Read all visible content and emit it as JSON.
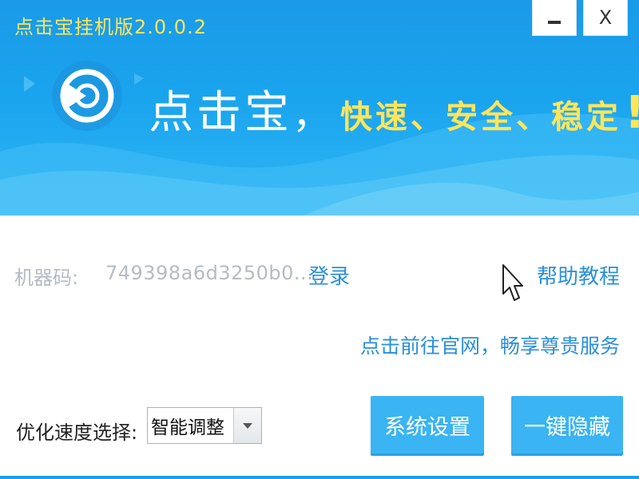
{
  "window": {
    "title": "点击宝挂机版2.0.0.2",
    "minimize_label": "—",
    "close_label": "X"
  },
  "banner": {
    "slogan_main": "点击宝",
    "slogan_comma": "，",
    "slogan_sub": "快速、安全、稳定",
    "slogan_excl": "!"
  },
  "account": {
    "machine_label": "机器码:",
    "machine_code": "749398a6d3250b0...",
    "login_label": "登录",
    "help_label": "帮助教程"
  },
  "promo": {
    "text": "点击前往官网，畅享尊贵服务"
  },
  "speed": {
    "label": "优化速度选择:",
    "selected": "智能调整"
  },
  "actions": {
    "settings_label": "系统设置",
    "hide_label": "一键隐藏"
  },
  "colors": {
    "banner_blue": "#1aa4ee",
    "title_yellow": "#ffe55a",
    "link_blue": "#2b8fd9",
    "button_blue": "#3ab4f2"
  },
  "icons": {
    "logo": "play-circle-logo-icon",
    "cursor": "mouse-pointer-icon",
    "dropdown": "chevron-down-icon"
  }
}
